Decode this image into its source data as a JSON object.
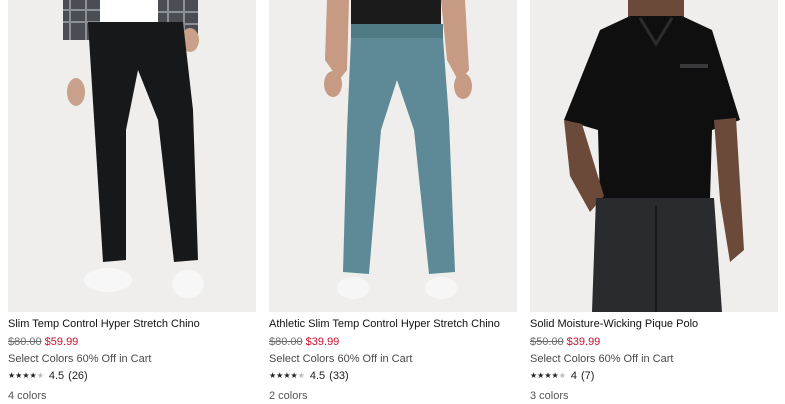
{
  "products": [
    {
      "name": "Slim Temp Control Hyper Stretch Chino",
      "was_price": "$80.00",
      "sale_price": "$59.99",
      "promo": "Select Colors 60% Off in Cart",
      "stars_full": 4,
      "stars_text": "★★★★",
      "rating": "4.5",
      "review_count": "(26)",
      "colors": "4 colors",
      "image_icon": "black-chino-pants-image",
      "pants_color": "#17181a",
      "top_color": "#ffffff"
    },
    {
      "name": "Athletic Slim Temp Control Hyper Stretch Chino",
      "was_price": "$80.00",
      "sale_price": "$39.99",
      "promo": "Select Colors 60% Off in Cart",
      "stars_full": 4,
      "stars_text": "★★★★",
      "rating": "4.5",
      "review_count": "(33)",
      "colors": "2 colors",
      "image_icon": "blue-chino-pants-image",
      "pants_color": "#5d8a96",
      "top_color": "#1b1b1b"
    },
    {
      "name": "Solid Moisture-Wicking Pique Polo",
      "was_price": "$50.00",
      "sale_price": "$39.99",
      "promo": "Select Colors 60% Off in Cart",
      "stars_full": 4,
      "stars_text": "★★★★",
      "rating": "4",
      "review_count": "(7)",
      "colors": "3 colors",
      "image_icon": "black-polo-shirt-image",
      "pants_color": "#2a2b2e",
      "top_color": "#0f0f10"
    }
  ],
  "colors": {
    "sale_red": "#c8102e",
    "image_bg": "#efeeec"
  }
}
